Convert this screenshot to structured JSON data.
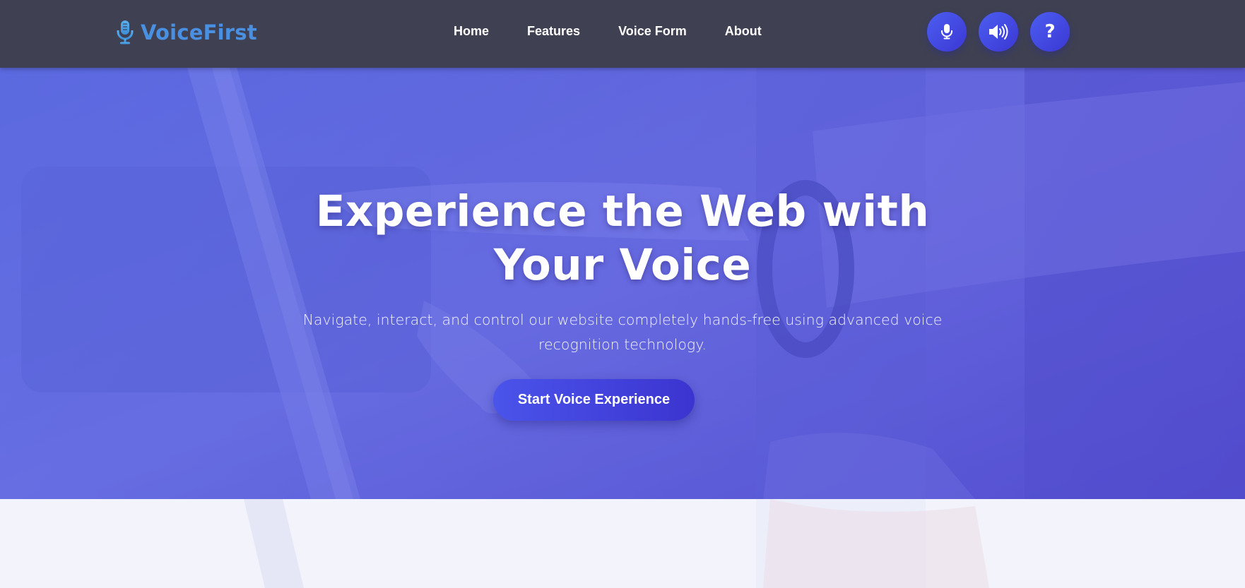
{
  "header": {
    "brand": "VoiceFirst",
    "nav": [
      {
        "label": "Home"
      },
      {
        "label": "Features"
      },
      {
        "label": "Voice Form"
      },
      {
        "label": "About"
      }
    ],
    "help_label": "?"
  },
  "hero": {
    "title_line1": "Experience the Web with",
    "title_line2": "Your Voice",
    "subtitle_line1": "Navigate, interact, and control our website completely hands-free using advanced voice",
    "subtitle_line2": "recognition technology.",
    "cta_label": "Start Voice Experience"
  },
  "colors": {
    "navbar": "#3f4152",
    "brand": "#4a90e2",
    "accent": "#4552e6",
    "hero_tint": "#5f66db"
  },
  "icons": [
    "microphone-icon",
    "speaker-icon",
    "help-icon"
  ]
}
